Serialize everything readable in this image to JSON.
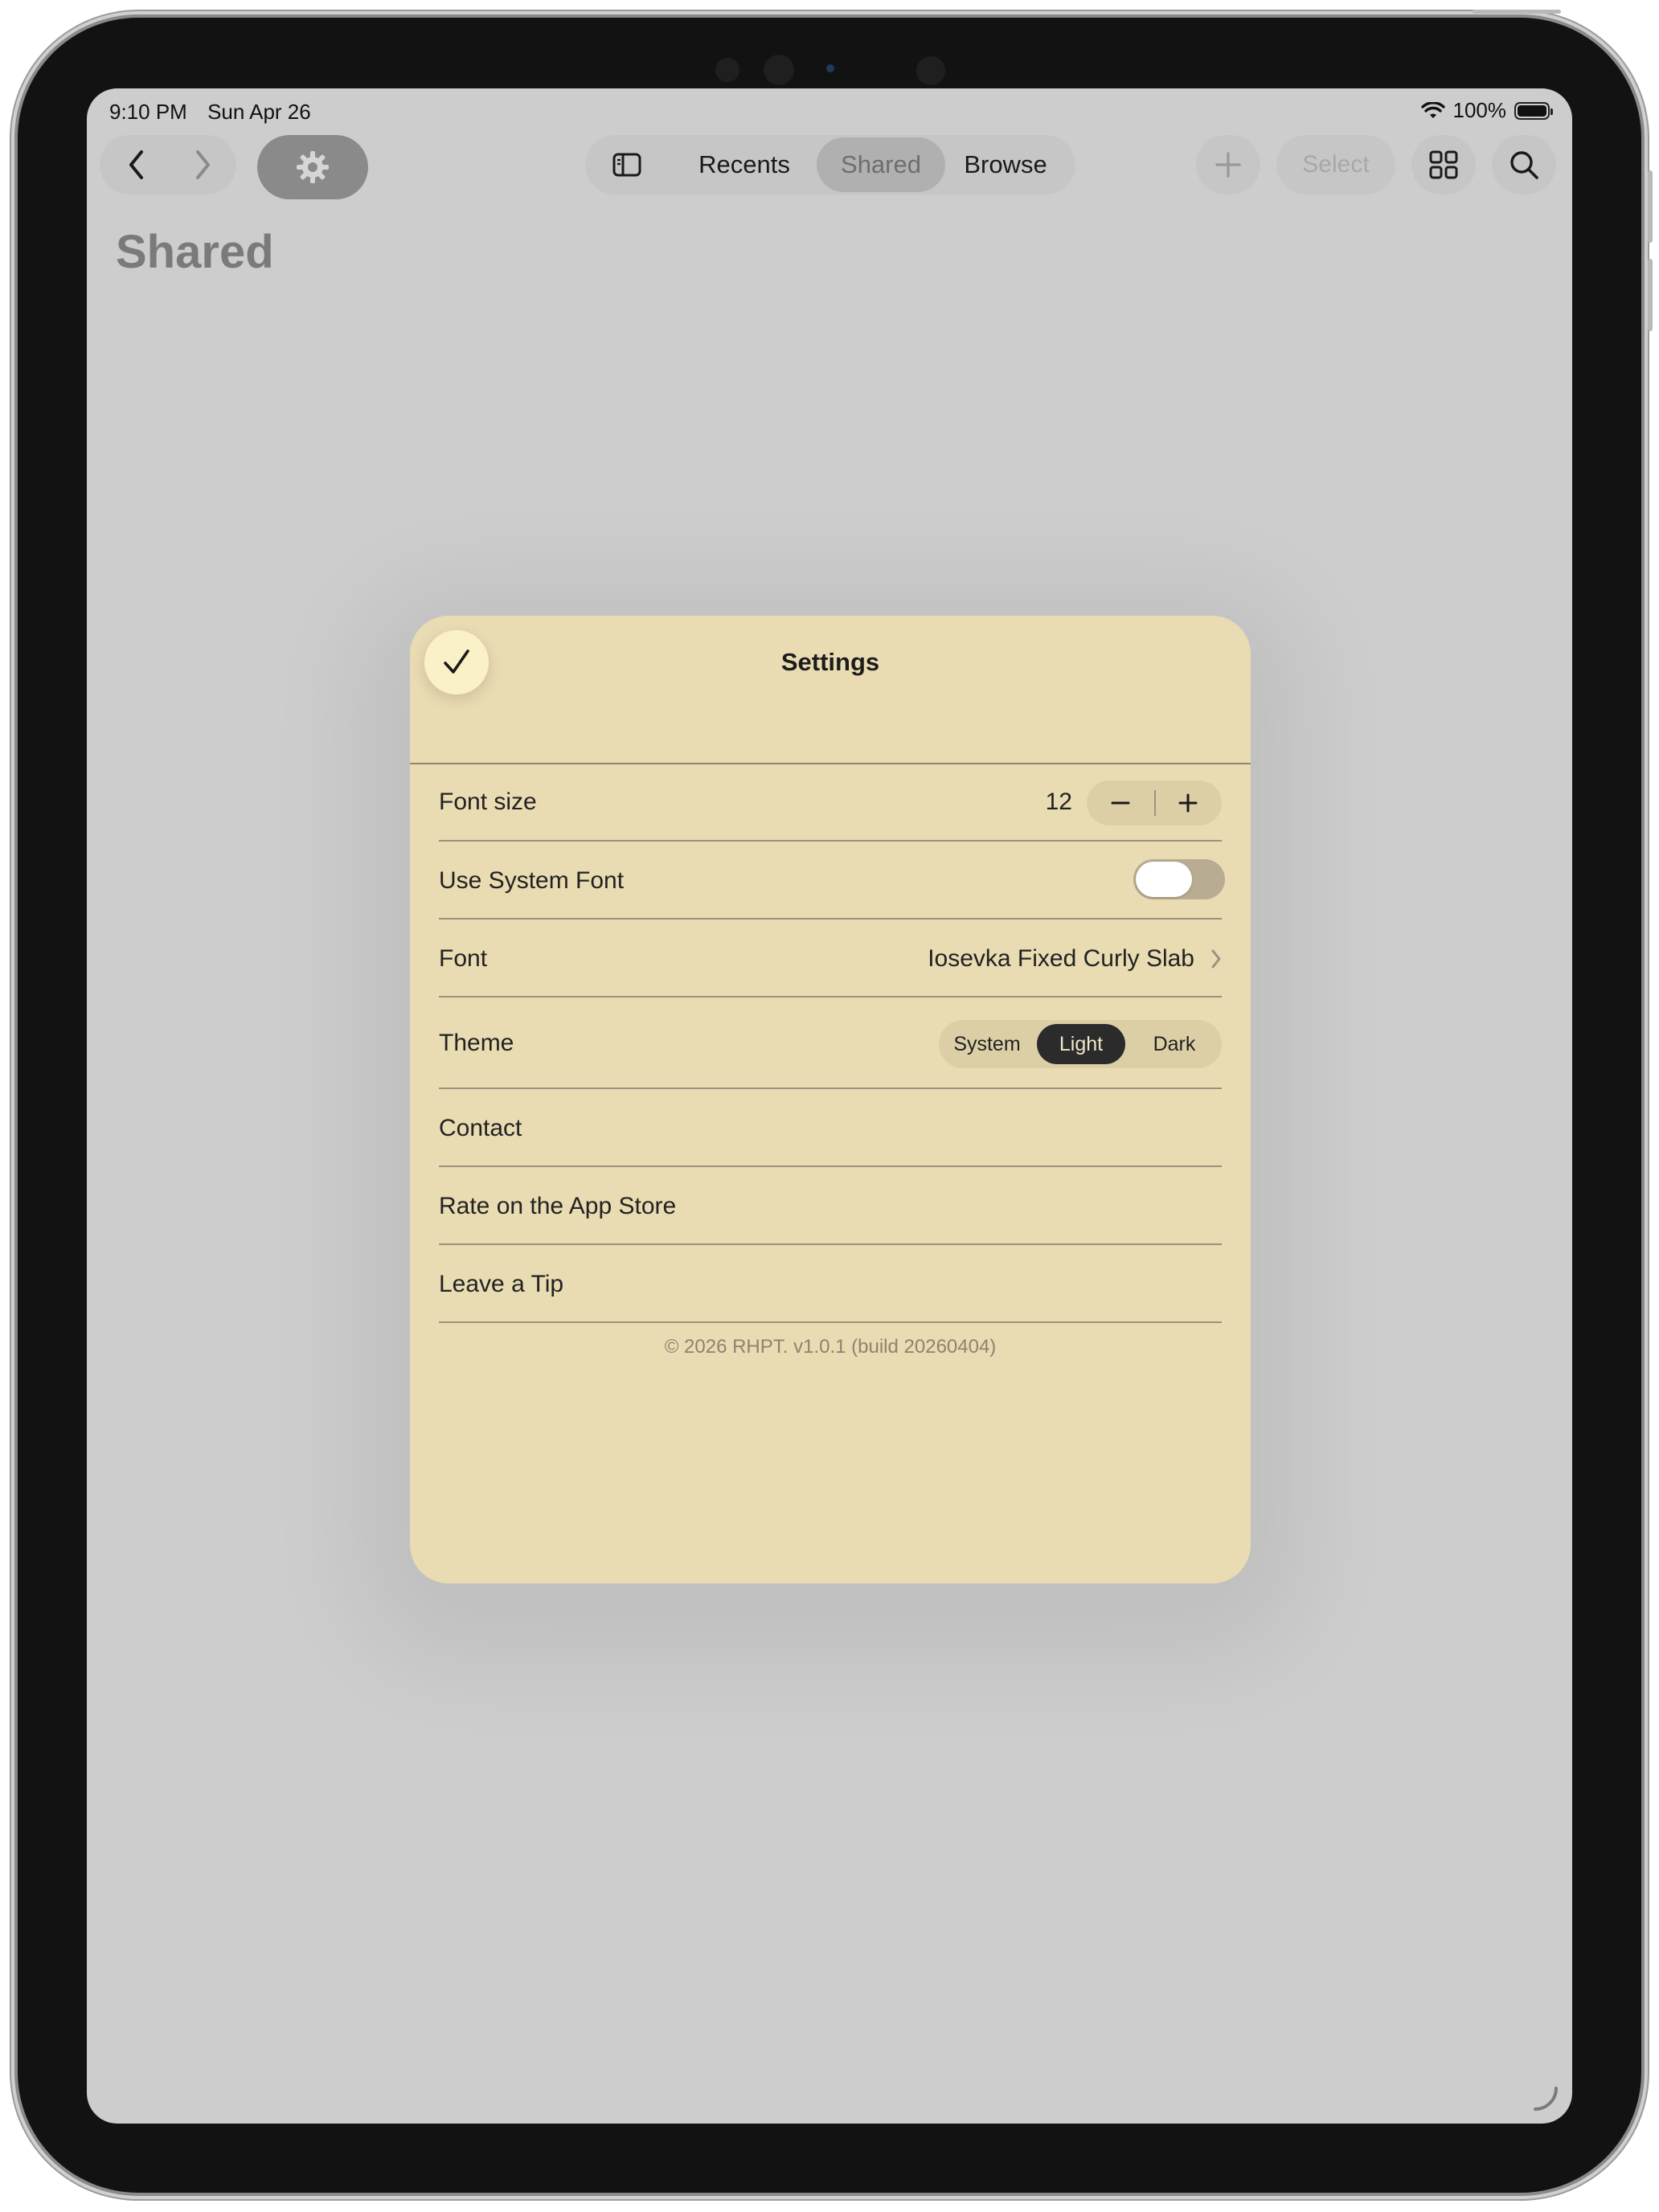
{
  "status_bar": {
    "time": "9:10 PM",
    "date": "Sun Apr 26",
    "battery": "100%"
  },
  "toolbar": {
    "back_icon": "chevron-left-icon",
    "forward_icon": "chevron-right-icon",
    "settings_icon": "gear-icon",
    "sidebar_icon": "sidebar-icon",
    "tabs": [
      {
        "label": "Recents",
        "selected": false
      },
      {
        "label": "Shared",
        "selected": true
      },
      {
        "label": "Browse",
        "selected": false
      }
    ],
    "add_icon": "plus-icon",
    "select_label": "Select",
    "grid_icon": "grid-icon",
    "search_icon": "search-icon"
  },
  "page": {
    "title": "Shared"
  },
  "settings_sheet": {
    "done_icon": "checkmark-icon",
    "title": "Settings",
    "font_size": {
      "label": "Font size",
      "value": "12",
      "decrement_icon": "minus-icon",
      "increment_icon": "plus-icon"
    },
    "system_font": {
      "label": "Use System Font",
      "enabled": false
    },
    "font": {
      "label": "Font",
      "value": "Iosevka Fixed Curly Slab",
      "chevron_icon": "chevron-right-icon"
    },
    "theme": {
      "label": "Theme",
      "options": [
        "System",
        "Light",
        "Dark"
      ],
      "selected": "Light"
    },
    "links": [
      {
        "label": "Contact"
      },
      {
        "label": "Rate on the App Store"
      },
      {
        "label": "Leave a Tip"
      }
    ],
    "footer": "© 2026 RHPT. v1.0.1 (build 20260404)"
  },
  "colors": {
    "sheet_background": "#e9dbb2",
    "screen_dim": "#cdcdcd",
    "selected_theme": "#2b2b2b"
  }
}
